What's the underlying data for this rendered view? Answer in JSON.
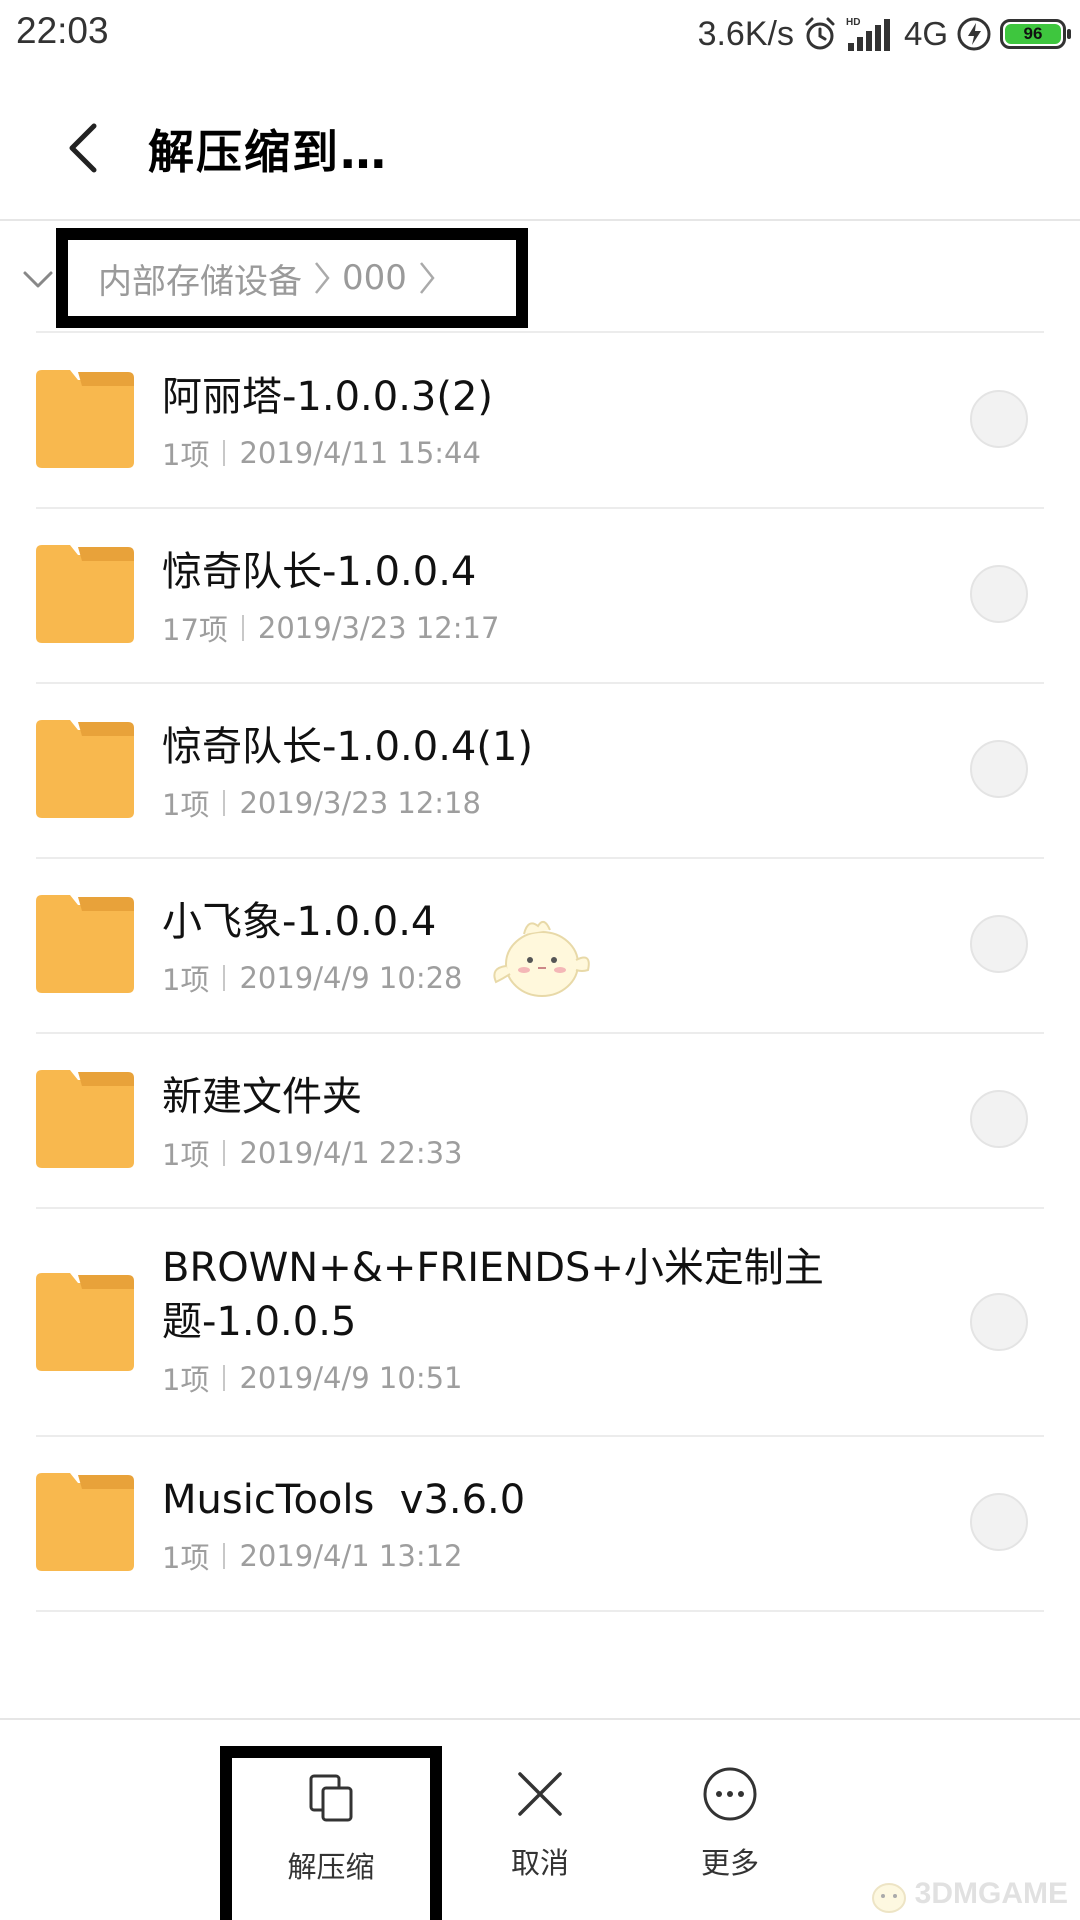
{
  "status_bar": {
    "time": "22:03",
    "net_speed": "3.6K/s",
    "network_type": "4G",
    "battery_level": "96",
    "icons": [
      "alarm-icon",
      "hd-signal-icon",
      "charging-icon",
      "battery-icon"
    ]
  },
  "header": {
    "title": "解压缩到…",
    "back_icon": "chevron-left-icon"
  },
  "breadcrumb": {
    "items": [
      "内部存储设备",
      "000"
    ]
  },
  "folders": [
    {
      "name": "阿丽塔-1.0.0.3(2)",
      "count": "1项",
      "date": "2019/4/11 15:44"
    },
    {
      "name": "惊奇队长-1.0.0.4",
      "count": "17项",
      "date": "2019/3/23 12:17"
    },
    {
      "name": "惊奇队长-1.0.0.4(1)",
      "count": "1项",
      "date": "2019/3/23 12:18"
    },
    {
      "name": "小飞象-1.0.0.4",
      "count": "1项",
      "date": "2019/4/9 10:28"
    },
    {
      "name": "新建文件夹",
      "count": "1项",
      "date": "2019/4/1 22:33"
    },
    {
      "name": "BROWN+&+FRIENDS+小米定制主题-1.0.0.5",
      "count": "1项",
      "date": "2019/4/9 10:51"
    },
    {
      "name": "MusicTools  v3.6.0",
      "count": "1项",
      "date": "2019/4/1 13:12"
    }
  ],
  "bottom_bar": {
    "extract_label": "解压缩",
    "cancel_label": "取消",
    "more_label": "更多"
  },
  "watermark": {
    "text": "3DMGAME"
  },
  "colors": {
    "folder": "#f8b84e",
    "folder_tab": "#e8a23a",
    "battery": "#3ec63e",
    "highlight_box": "#000000"
  }
}
